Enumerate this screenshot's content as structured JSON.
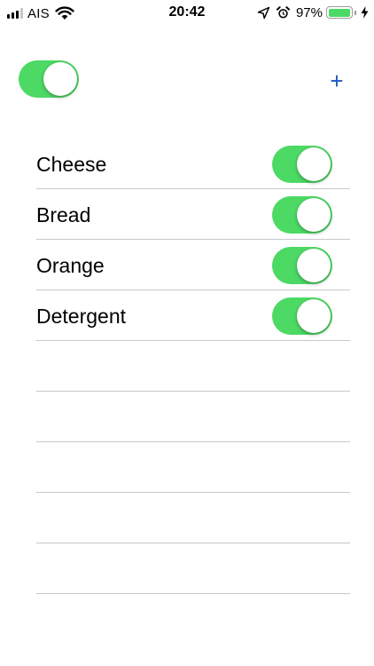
{
  "status_bar": {
    "carrier": "AIS",
    "time": "20:42",
    "battery_percent": "97%",
    "battery_level": 0.97,
    "icons": [
      "signal-icon",
      "wifi-icon",
      "location-icon",
      "alarm-icon",
      "battery-icon",
      "charging-bolt-icon"
    ]
  },
  "header": {
    "master_toggle_on": true,
    "add_label": "+"
  },
  "items": [
    {
      "label": "Cheese",
      "on": true
    },
    {
      "label": "Bread",
      "on": true
    },
    {
      "label": "Orange",
      "on": true
    },
    {
      "label": "Detergent",
      "on": true
    },
    {
      "label": "",
      "on": false
    },
    {
      "label": "",
      "on": false
    },
    {
      "label": "",
      "on": false
    },
    {
      "label": "",
      "on": false
    },
    {
      "label": "",
      "on": false
    }
  ],
  "colors": {
    "toggle_on": "#4cd964",
    "accent": "#1f56c4",
    "separator": "#c8c7cc"
  }
}
